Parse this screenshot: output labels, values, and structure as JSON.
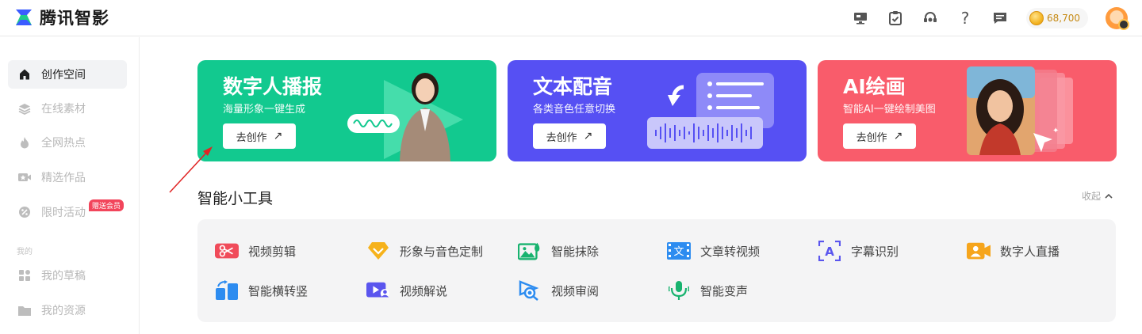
{
  "app": {
    "name": "腾讯智影"
  },
  "header": {
    "coin_amount": "68,700",
    "icons": [
      "desktop-icon",
      "clipboard-icon",
      "headset-icon",
      "help-icon",
      "message-icon"
    ]
  },
  "sidebar": {
    "items": [
      {
        "label": "创作空间",
        "icon": "home-icon",
        "active": true
      },
      {
        "label": "在线素材",
        "icon": "layers-icon"
      },
      {
        "label": "全网热点",
        "icon": "flame-icon"
      },
      {
        "label": "精选作品",
        "icon": "video-star-icon"
      },
      {
        "label": "限时活动",
        "icon": "discount-icon",
        "badge": "赠送会员"
      }
    ],
    "section_label": "我的",
    "my_items": [
      {
        "label": "我的草稿",
        "icon": "grid-icon"
      },
      {
        "label": "我的资源",
        "icon": "folder-icon"
      }
    ]
  },
  "banners": [
    {
      "title": "数字人播报",
      "subtitle": "海量形象一键生成",
      "button": "去创作",
      "color": "#12c98f"
    },
    {
      "title": "文本配音",
      "subtitle": "各类音色任意切换",
      "button": "去创作",
      "color": "#5650f3"
    },
    {
      "title": "AI绘画",
      "subtitle": "智能AI一键绘制美图",
      "button": "去创作",
      "color": "#f95c6b"
    }
  ],
  "tools": {
    "title": "智能小工具",
    "collapse_label": "收起",
    "items": [
      {
        "label": "视频剪辑",
        "icon": "scissors-icon"
      },
      {
        "label": "形象与音色定制",
        "icon": "diamond-icon"
      },
      {
        "label": "智能抹除",
        "icon": "image-erase-icon"
      },
      {
        "label": "文章转视频",
        "icon": "text-to-video-icon"
      },
      {
        "label": "字幕识别",
        "icon": "subtitle-icon"
      },
      {
        "label": "数字人直播",
        "icon": "live-avatar-icon"
      },
      {
        "label": "智能横转竖",
        "icon": "rotate-icon"
      },
      {
        "label": "视频解说",
        "icon": "video-narration-icon"
      },
      {
        "label": "视频审阅",
        "icon": "review-icon"
      },
      {
        "label": "智能变声",
        "icon": "microphone-icon"
      }
    ]
  }
}
